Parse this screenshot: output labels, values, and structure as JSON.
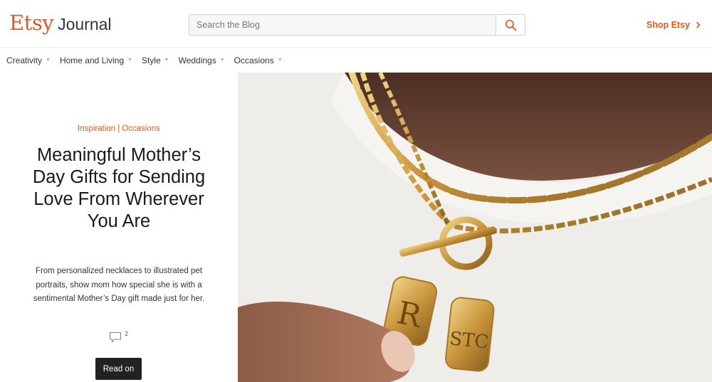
{
  "brand": {
    "name": "Etsy",
    "sub": "Journal",
    "accent": "#e05a1e"
  },
  "search": {
    "placeholder": "Search the Blog"
  },
  "header": {
    "shop_label": "Shop Etsy"
  },
  "nav": {
    "items": [
      {
        "label": "Creativity"
      },
      {
        "label": "Home and Living"
      },
      {
        "label": "Style"
      },
      {
        "label": "Weddings"
      },
      {
        "label": "Occasions"
      }
    ]
  },
  "feature": {
    "categories": [
      "Inspiration",
      "Occasions"
    ],
    "title": "Meaningful Mother’s Day Gifts for Sending Love From Wherever You Are",
    "excerpt": "From personalized necklaces to illustrated pet portraits, show mom how special she is with a sentimental Mother’s Day gift made just for her.",
    "comment_count": "2",
    "cta": "Read on"
  },
  "hero": {
    "description_icon": "necklace-photo",
    "pendant_letters": [
      "R",
      "STC"
    ]
  }
}
